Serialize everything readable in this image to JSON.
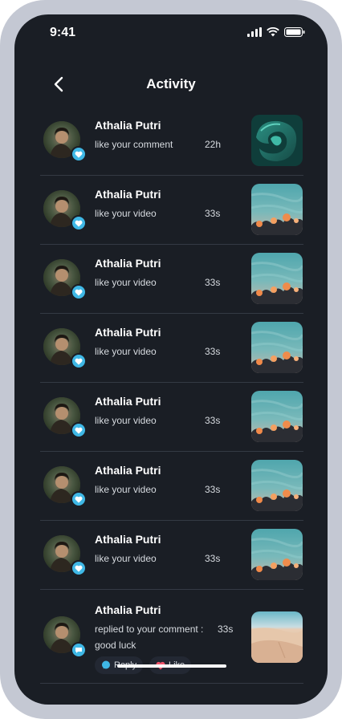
{
  "status_bar": {
    "time": "9:41"
  },
  "header": {
    "title": "Activity"
  },
  "activities": [
    {
      "name": "Athalia Putri",
      "action": "like your comment",
      "time": "22h",
      "thumb": "abstract"
    },
    {
      "name": "Athalia Putri",
      "action": "like your video",
      "time": "33s",
      "thumb": "sky"
    },
    {
      "name": "Athalia Putri",
      "action": "like your video",
      "time": "33s",
      "thumb": "sky"
    },
    {
      "name": "Athalia Putri",
      "action": "like your video",
      "time": "33s",
      "thumb": "sky"
    },
    {
      "name": "Athalia Putri",
      "action": "like your video",
      "time": "33s",
      "thumb": "sky"
    },
    {
      "name": "Athalia Putri",
      "action": "like your video",
      "time": "33s",
      "thumb": "sky"
    },
    {
      "name": "Athalia Putri",
      "action": "like your video",
      "time": "33s",
      "thumb": "sky"
    }
  ],
  "reply_item": {
    "name": "Athalia Putri",
    "action": "replied to your comment :",
    "comment": "good luck",
    "time": "33s",
    "reply_label": "Reply",
    "like_label": "Like"
  },
  "colors": {
    "background": "#1a1e25",
    "badge": "#3fb8e6",
    "frame": "#c4c8d3"
  }
}
